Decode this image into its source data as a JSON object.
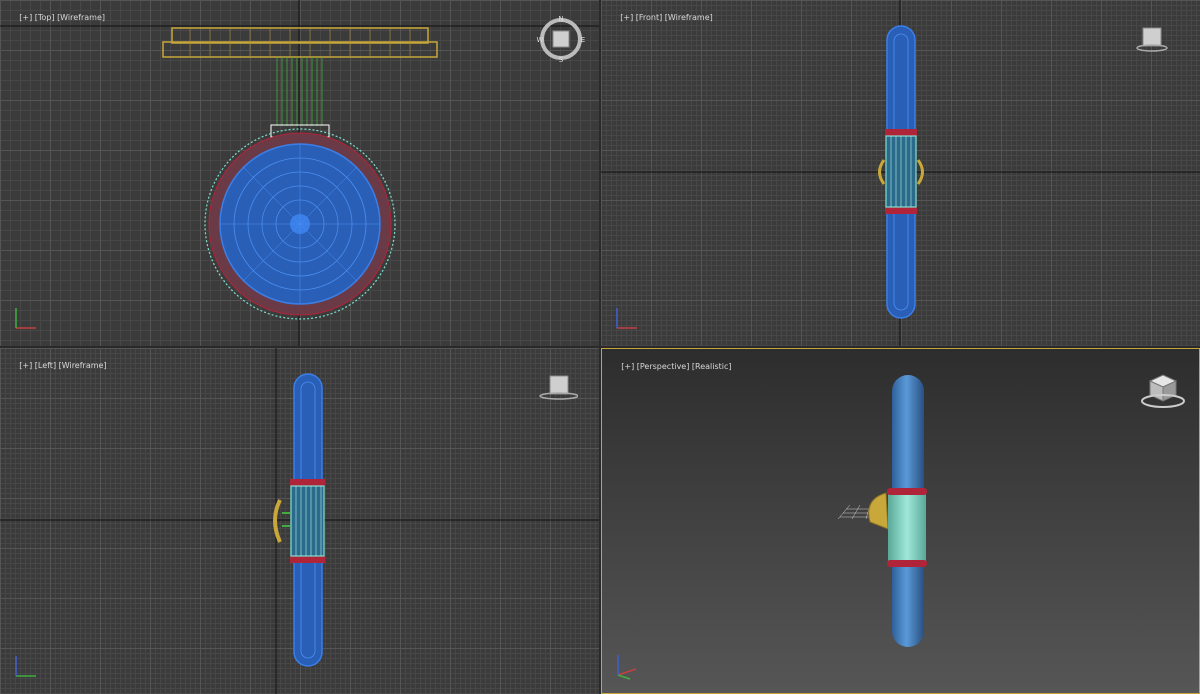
{
  "viewports": {
    "top": {
      "plus": "[+]",
      "view": "[Top]",
      "mode": "[Wireframe]"
    },
    "front": {
      "plus": "[+]",
      "view": "[Front]",
      "mode": "[Wireframe]"
    },
    "left": {
      "plus": "[+]",
      "view": "[Left]",
      "mode": "[Wireframe]"
    },
    "perspective": {
      "plus": "[+]",
      "view": "[Perspective]",
      "mode": "[Realistic]"
    }
  },
  "compass": {
    "n": "N",
    "s": "S",
    "e": "E",
    "w": "W"
  },
  "colors": {
    "active_border": "#c8a53a",
    "tube_blue": "#2f6fd0",
    "ring_red": "#b0243a",
    "band_cyan": "#7fe0d0",
    "mount_yellow": "#c8a83a",
    "rod_green": "#3fae3f"
  },
  "icons": [
    "viewcube-icon",
    "compass-icon",
    "axis-gizmo-icon"
  ]
}
